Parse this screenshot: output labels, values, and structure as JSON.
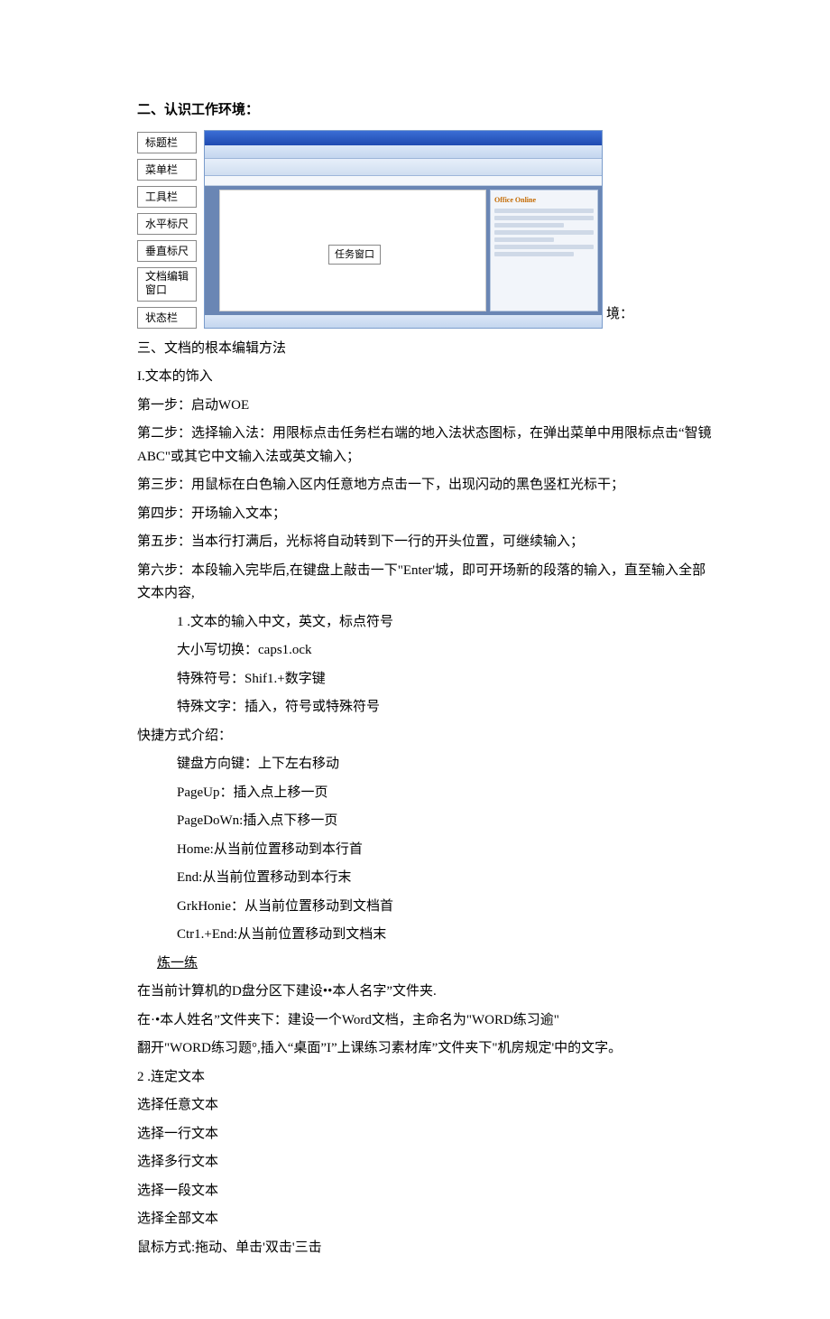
{
  "heading_env": "二、认识工作环境：",
  "callouts": {
    "title_bar": "标题栏",
    "menu_bar": "菜单栏",
    "tool_bar": "工具栏",
    "h_ruler": "水平标尺",
    "v_ruler": "垂直标尺",
    "edit_area": "文档编辑\n窗口",
    "status_bar": "状态栏",
    "task_pane": "任务窗口",
    "task_label": "Office Online"
  },
  "trail": "境：",
  "heading3": "三、文档的根本编辑方法",
  "sec1_title": "I.文本的饰入",
  "step1": "第一步：启动WOE",
  "step2": "第二步：选择输入法：用限标点击任务栏右端的地入法状态图标，在弹出菜单中用限标点击“智镜ABC\"或其它中文输入法或英文输入；",
  "step3": "第三步：用鼠标在白色输入区内任意地方点击一下，出现闪动的黑色竖杠光标干；",
  "step4": "第四步：开场输入文本；",
  "step5": "第五步：当本行打满后，光标将自动转到下一行的开头位置，可继续输入；",
  "step6": "第六步：本段输入完毕后,在键盘上敲击一下\"Enter'城，即可开场新的段落的输入，直至输入全部文本内容,",
  "sub1": "1 .文本的输入中文，英文，标点符号",
  "caps": "大小写切换：caps1.ock",
  "shift": "特殊符号：Shif1.+数字键",
  "special": "特殊文字：插入，符号或特殊符号",
  "shortcut_title": "快捷方式介绍：",
  "sc_arrow": "键盘方向键：上下左右移动",
  "sc_pgup": "PageUp：插入点上移一页",
  "sc_pgdn": "PageDoWn:插入点下移一页",
  "sc_home": "Home:从当前位置移动到本行首",
  "sc_end": "End:从当前位置移动到本行末",
  "sc_ctrlhome": "GrkHonie：从当前位置移动到文档首",
  "sc_ctrlend": "Ctr1.+End:从当前位置移动到文档末",
  "practice": "炼一练",
  "p1": "在当前计算机的D盘分区下建设••本人名字”文件夹.",
  "p2": "在·•本人姓名”文件夹下：建设一个Word文档，主命名为\"WORD练习逾\"",
  "p3": "翻开\"WORD练习题°,插入“桌面”I”上课练习素材库”文件夹下\"机房规定'中的文字。",
  "sec2": "2  .连定文本",
  "sel1": "选择任意文本",
  "sel2": "选择一行文本",
  "sel3": "选择多行文本",
  "sel4": "选择一段文本",
  "sel5": "选择全部文本",
  "mouse": "鼠标方式:拖动、单击'双击'三击"
}
